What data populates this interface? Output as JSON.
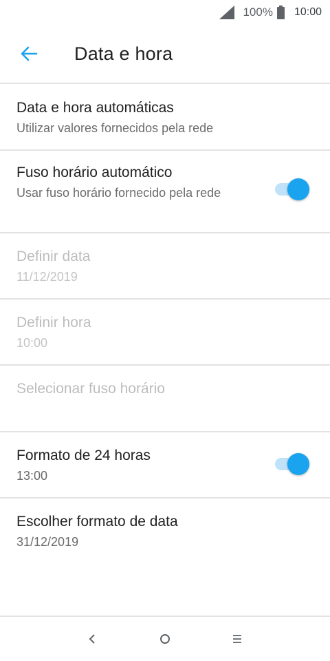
{
  "status_bar": {
    "battery_percent": "100%",
    "time": "10:00",
    "icons": [
      "signal-icon",
      "battery-icon"
    ]
  },
  "app_bar": {
    "title": "Data e hora",
    "back_icon": "arrow-back-icon"
  },
  "settings": [
    {
      "title": "Data e hora automáticas",
      "summary": "Utilizar valores fornecidos pela rede",
      "enabled": true,
      "switch": null
    },
    {
      "title": "Fuso horário automático",
      "summary": "Usar fuso horário fornecido pela rede",
      "enabled": true,
      "switch": true
    },
    {
      "title": "Definir data",
      "summary": "11/12/2019",
      "enabled": false,
      "switch": null
    },
    {
      "title": "Definir hora",
      "summary": "10:00",
      "enabled": false,
      "switch": null
    },
    {
      "title": "Selecionar fuso horário",
      "summary": "",
      "enabled": false,
      "switch": null
    },
    {
      "title": "Formato de 24 horas",
      "summary": "13:00",
      "enabled": true,
      "switch": true
    },
    {
      "title": "Escolher formato de data",
      "summary": "31/12/2019",
      "enabled": true,
      "switch": null
    }
  ],
  "nav_bar": {
    "icons": [
      "nav-back-icon",
      "nav-home-icon",
      "nav-menu-icon"
    ]
  },
  "colors": {
    "accent": "#1aa3ee",
    "switch_track": "#bfe2f8",
    "divider": "#e3e3e3",
    "disabled_text": "#bdbdbd"
  }
}
